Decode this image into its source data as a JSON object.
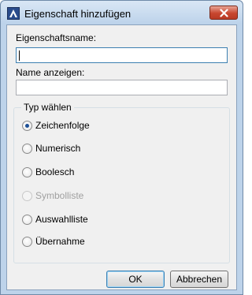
{
  "window": {
    "title": "Eigenschaft hinzufügen",
    "icon": "autocad-icon",
    "close_icon": "close-icon"
  },
  "fields": {
    "property_name_label": "Eigenschaftsname:",
    "property_name_value": "",
    "display_name_label": "Name anzeigen:",
    "display_name_value": ""
  },
  "type_group": {
    "legend": "Typ wählen",
    "options": [
      {
        "label": "Zeichenfolge",
        "checked": true,
        "enabled": true
      },
      {
        "label": "Numerisch",
        "checked": false,
        "enabled": true
      },
      {
        "label": "Boolesch",
        "checked": false,
        "enabled": true
      },
      {
        "label": "Symbolliste",
        "checked": false,
        "enabled": false
      },
      {
        "label": "Auswahlliste",
        "checked": false,
        "enabled": true
      },
      {
        "label": "Übernahme",
        "checked": false,
        "enabled": true
      }
    ]
  },
  "buttons": {
    "ok": "OK",
    "cancel": "Abbrechen"
  },
  "colors": {
    "frame": "#bdd3ea",
    "close_button": "#c8462f",
    "radio_dot": "#1c4f96",
    "disabled_text": "#a0a0a0"
  }
}
